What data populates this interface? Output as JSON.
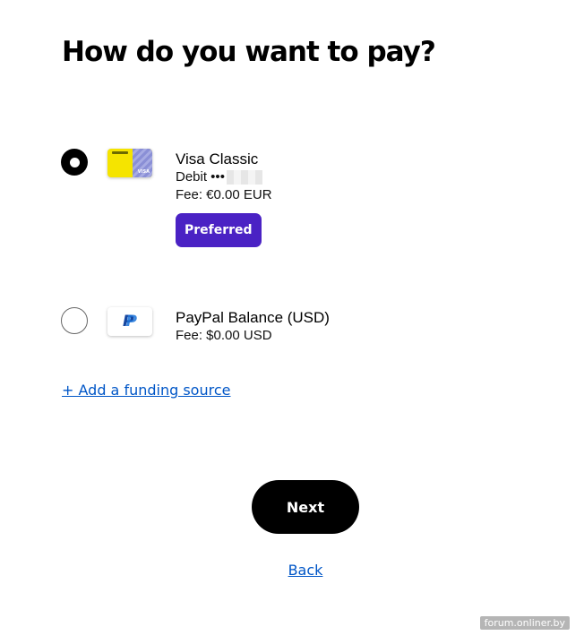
{
  "page": {
    "title": "How do you want to pay?"
  },
  "options": [
    {
      "name": "Visa Classic",
      "detail": "Debit •••",
      "fee": "Fee: €0.00 EUR",
      "badge": "Preferred",
      "selected": true,
      "icon": "visa-card-icon"
    },
    {
      "name": "PayPal Balance (USD)",
      "fee": "Fee: $0.00 USD",
      "selected": false,
      "icon": "paypal-icon"
    }
  ],
  "add_funding_label": "+ Add a funding source",
  "next_label": "Next",
  "back_label": "Back",
  "watermark": "forum.onliner.by",
  "colors": {
    "badge": "#4a22c4",
    "link": "#0056c7",
    "primary_button": "#000000",
    "visa_card": "#f5e400"
  }
}
